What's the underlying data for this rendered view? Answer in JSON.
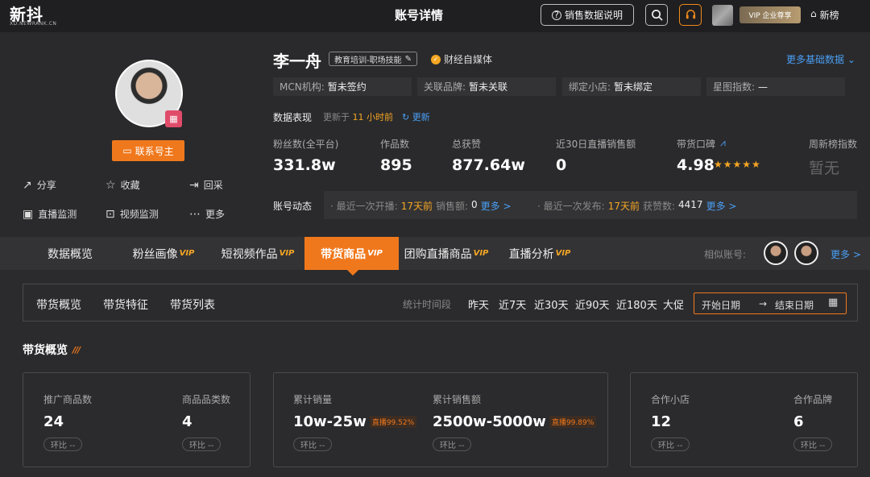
{
  "app": {
    "logo": "新抖",
    "logo_sub": "XD.NEWRANK.CN",
    "page_title": "账号详情"
  },
  "header": {
    "sales_data_label": "销售数据说明",
    "vip_label": "VIP 企业尊享",
    "xinbang_label": "新榜"
  },
  "profile": {
    "name": "李一舟",
    "tag": "教育培训-职场技能",
    "verified": "财经自媒体",
    "contact_label": "联系号主",
    "more_basic": "更多基础数据",
    "actions": [
      {
        "label": "分享",
        "icon": "share-icon"
      },
      {
        "label": "收藏",
        "icon": "star-outline-icon"
      },
      {
        "label": "回采",
        "icon": "recollect-icon"
      },
      {
        "label": "直播监测",
        "icon": "live-monitor-icon"
      },
      {
        "label": "视频监测",
        "icon": "video-monitor-icon"
      },
      {
        "label": "更多",
        "icon": "more-dots-icon"
      }
    ],
    "info": [
      {
        "label": "MCN机构:",
        "value": "暂未签约"
      },
      {
        "label": "关联品牌:",
        "value": "暂未关联"
      },
      {
        "label": "绑定小店:",
        "value": "暂未绑定"
      },
      {
        "label": "星图指数:",
        "value": "—"
      }
    ]
  },
  "performance": {
    "label": "数据表现",
    "update_prefix": "更新于",
    "update_time": "11 小时前",
    "refresh_label": "更新",
    "stats": [
      {
        "label": "粉丝数(全平台)",
        "value": "331.8w"
      },
      {
        "label": "作品数",
        "value": "895"
      },
      {
        "label": "总获赞",
        "value": "877.64w"
      },
      {
        "label": "近30日直播销售额",
        "value": "0"
      },
      {
        "label": "带货口碑",
        "value": "4.98",
        "stars": "★★★★★",
        "rating": 4.98
      },
      {
        "label": "周新榜指数",
        "value": "暂无"
      }
    ]
  },
  "dynamics": {
    "label": "账号动态",
    "live_prefix": "· 最近一次开播:",
    "live_time": "17天前",
    "live_sales_label": "销售额:",
    "live_sales_value": "0",
    "live_more": "更多 >",
    "post_prefix": "· 最近一次发布:",
    "post_time": "17天前",
    "post_likes_label": "获赞数:",
    "post_likes_value": "4417",
    "post_more": "更多 >"
  },
  "tabs": {
    "items": [
      {
        "label": "数据概览",
        "vip": ""
      },
      {
        "label": "粉丝画像",
        "vip": "VIP"
      },
      {
        "label": "短视频作品",
        "vip": "VIP"
      },
      {
        "label": "带货商品",
        "vip": "VIP"
      },
      {
        "label": "团购直播商品",
        "vip": "VIP"
      },
      {
        "label": "直播分析",
        "vip": "VIP"
      }
    ],
    "similar_label": "相似账号:",
    "more_label": "更多 >"
  },
  "subtabs": {
    "items": [
      "带货概览",
      "带货特征",
      "带货列表"
    ],
    "period_label": "统计时间段",
    "periods": [
      "昨天",
      "近7天",
      "近30天",
      "近90天",
      "近180天",
      "大促"
    ],
    "start_placeholder": "开始日期",
    "arrow": "→",
    "end_placeholder": "结束日期"
  },
  "overview": {
    "title": "带货概览",
    "cards": [
      {
        "metrics": [
          {
            "label": "推广商品数",
            "value": "24",
            "pct": "",
            "hb": "环比 --"
          },
          {
            "label": "商品品类数",
            "value": "4",
            "pct": "",
            "hb": "环比 --"
          }
        ]
      },
      {
        "metrics": [
          {
            "label": "累计销量",
            "value": "10w-25w",
            "pct": "直播99.52%",
            "hb": "环比 --"
          },
          {
            "label": "累计销售额",
            "value": "2500w-5000w",
            "pct": "直播99.89%",
            "hb": "环比 --"
          }
        ]
      },
      {
        "metrics": [
          {
            "label": "合作小店",
            "value": "12",
            "pct": "",
            "hb": "环比 --"
          },
          {
            "label": "合作品牌",
            "value": "6",
            "pct": "",
            "hb": "环比 --"
          }
        ]
      }
    ]
  },
  "colors": {
    "accent": "#f0781c",
    "link": "#4a9ff5",
    "star": "#f5a623"
  }
}
